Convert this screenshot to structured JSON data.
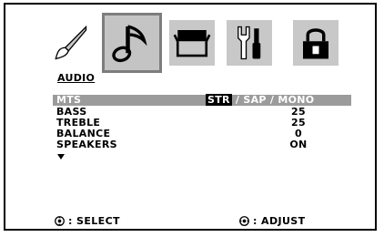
{
  "tabs": [
    {
      "id": "picture",
      "icon": "paintbrush-icon",
      "selected": false
    },
    {
      "id": "audio",
      "icon": "music-note-icon",
      "selected": true
    },
    {
      "id": "channel",
      "icon": "box-icon",
      "selected": false
    },
    {
      "id": "setup",
      "icon": "tools-icon",
      "selected": false
    },
    {
      "id": "lock",
      "icon": "padlock-icon",
      "selected": false
    }
  ],
  "section": {
    "title": "AUDIO"
  },
  "menu": {
    "mts": {
      "label": "MTS",
      "options": [
        "STR",
        "SAP",
        "MONO"
      ],
      "selected_option": "STR",
      "separator": " / "
    },
    "bass": {
      "label": "BASS",
      "value": "25"
    },
    "treble": {
      "label": "TREBLE",
      "value": "25"
    },
    "balance": {
      "label": "BALANCE",
      "value": "0"
    },
    "speakers": {
      "label": "SPEAKERS",
      "value": "ON"
    },
    "more_icon": "down-arrow-icon"
  },
  "footer": {
    "select_label": ": SELECT",
    "adjust_label": ": ADJUST",
    "select_icon": "remote-updown-icon",
    "adjust_icon": "remote-leftright-icon"
  },
  "colors": {
    "highlight_row": "#9b9b9b",
    "tab_background": "#c8c8c8",
    "selected_tab_border": "#7d7d7d",
    "text": "#000000"
  }
}
